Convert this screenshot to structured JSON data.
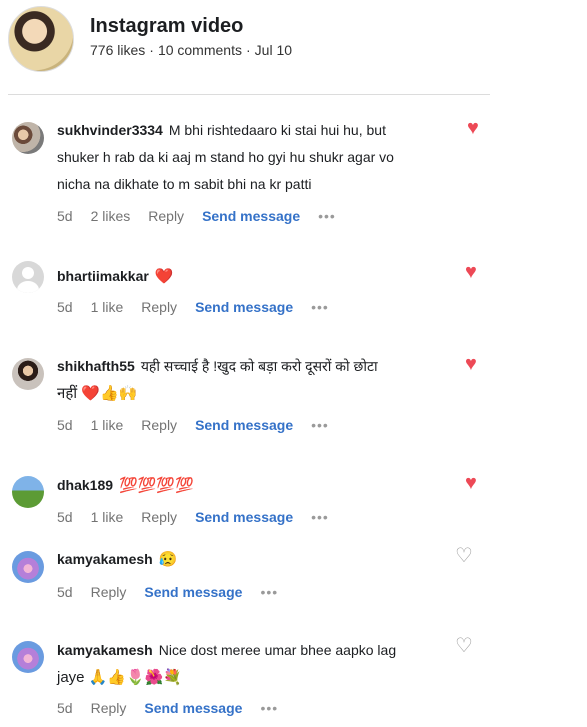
{
  "post": {
    "title": "Instagram video",
    "likes": "776 likes",
    "comments": "10 comments",
    "date": "Jul 10"
  },
  "comments": [
    {
      "username": "sukhvinder3334",
      "text": "M bhi rishtedaaro ki stai hui hu, but",
      "text_line2": "shuker h rab da ki aaj m stand ho gyi hu shukr agar vo",
      "text_line3": "nicha na dikhate to m sabit bhi na kr patti",
      "age": "5d",
      "likes": "2 likes",
      "reply": "Reply",
      "send": "Send message",
      "dots": "•••",
      "liked": true
    },
    {
      "username": "bhartiimakkar",
      "text": "❤️",
      "age": "5d",
      "likes": "1 like",
      "reply": "Reply",
      "send": "Send message",
      "dots": "•••",
      "liked": true
    },
    {
      "username": "shikhafth55",
      "text": "यही सच्चाई है !खुद को बड़ा करो दूसरों को छोटा",
      "text_line2": "नहीं ❤️👍🙌",
      "age": "5d",
      "likes": "1 like",
      "reply": "Reply",
      "send": "Send message",
      "dots": "•••",
      "liked": true
    },
    {
      "username": "dhak189",
      "text": "💯💯💯💯",
      "age": "5d",
      "likes": "1 like",
      "reply": "Reply",
      "send": "Send message",
      "dots": "•••",
      "liked": true
    },
    {
      "username": "kamyakamesh",
      "text": "😥",
      "age": "5d",
      "reply": "Reply",
      "send": "Send message",
      "dots": "•••",
      "liked": false
    },
    {
      "username": "kamyakamesh",
      "text": "Nice dost meree umar bhee aapko lag",
      "text_line2": "jaye 🙏👍🌷🌺💐",
      "age": "5d",
      "reply": "Reply",
      "send": "Send message",
      "dots": "•••",
      "liked": false
    }
  ],
  "icons": {
    "heart_filled": "♥",
    "heart_outline": "♡"
  },
  "colors": {
    "heart": "#ed4956",
    "link": "#3572c8",
    "muted": "#737373"
  }
}
